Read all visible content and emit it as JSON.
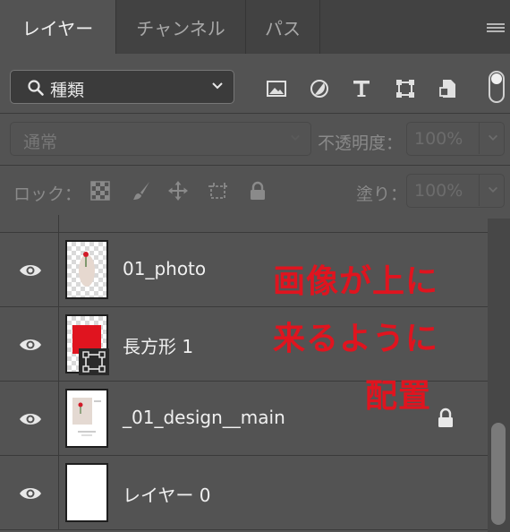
{
  "tabs": [
    {
      "label": "レイヤー",
      "active": true
    },
    {
      "label": "チャンネル",
      "active": false
    },
    {
      "label": "パス",
      "active": false
    }
  ],
  "filter": {
    "kind_label": "種類",
    "icons": [
      "image-filter-icon",
      "adjustment-filter-icon",
      "type-filter-icon",
      "shape-filter-icon",
      "smart-object-filter-icon"
    ]
  },
  "blend": {
    "mode": "通常",
    "opacity_label": "不透明度：",
    "opacity_value": "100%"
  },
  "lock": {
    "label": "ロック：",
    "fill_label": "塗り：",
    "fill_value": "100%"
  },
  "layers": [
    {
      "name": "01_photo",
      "visible": true,
      "thumb": "photo-transparent",
      "locked": false
    },
    {
      "name": "長方形 1",
      "visible": true,
      "thumb": "red-rectangle-shape",
      "locked": false
    },
    {
      "name": "_01_design__main",
      "visible": true,
      "thumb": "design-page",
      "locked": true
    },
    {
      "name": "レイヤー 0",
      "visible": true,
      "thumb": "white",
      "locked": false
    }
  ],
  "annotation": {
    "lines": [
      "画像が上に",
      "来るように",
      "配置"
    ],
    "color": "#e0141f"
  },
  "colors": {
    "panel": "#535353",
    "tabbar": "#424242",
    "red": "#e0141f"
  }
}
